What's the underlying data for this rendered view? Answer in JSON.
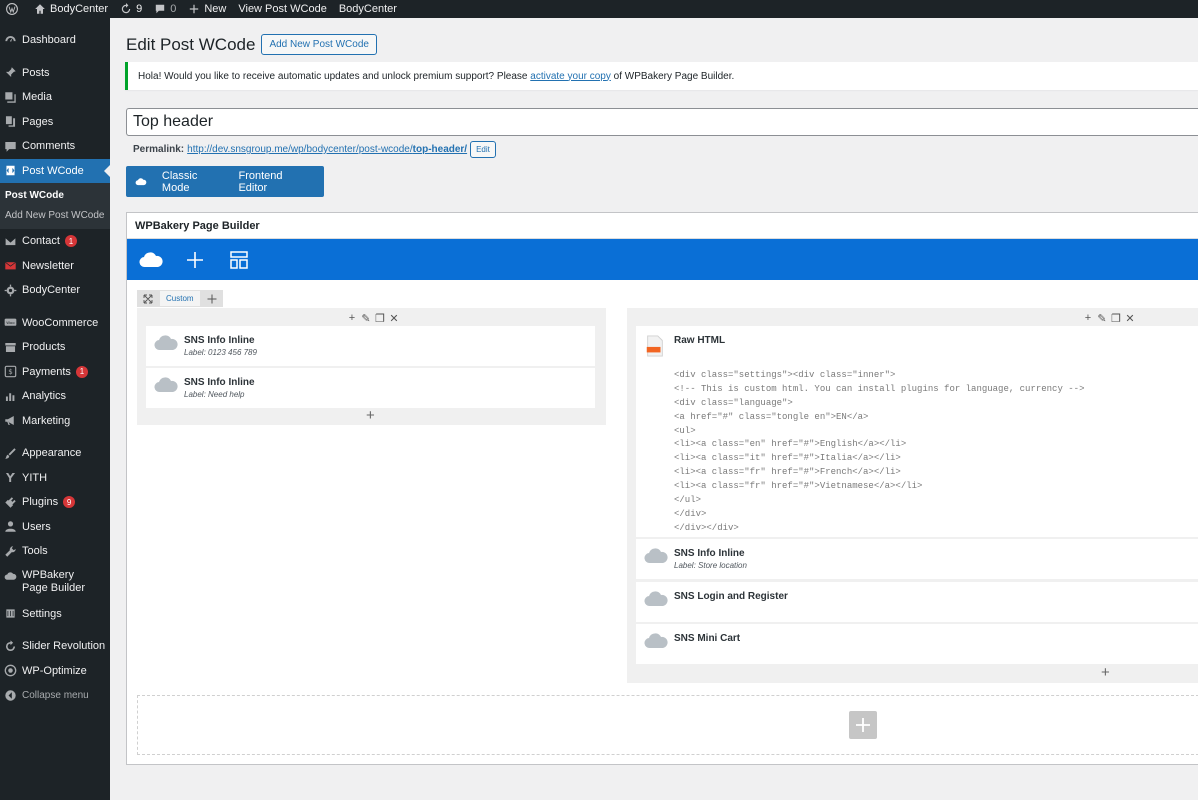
{
  "adminbar": {
    "site_name": "BodyCenter",
    "updates_count": "9",
    "comments_count": "0",
    "new_label": "New",
    "view_label": "View Post WCode",
    "theme_label": "BodyCenter"
  },
  "sidebar": {
    "items": [
      {
        "label": "Dashboard",
        "icon": "dashboard-icon"
      },
      {
        "label": "Posts",
        "icon": "pin-icon"
      },
      {
        "label": "Media",
        "icon": "media-icon"
      },
      {
        "label": "Pages",
        "icon": "pages-icon"
      },
      {
        "label": "Comments",
        "icon": "comments-icon"
      },
      {
        "label": "Post WCode",
        "icon": "code-icon",
        "current": true
      },
      {
        "label": "Contact",
        "icon": "mail-icon",
        "badge": "1"
      },
      {
        "label": "Newsletter",
        "icon": "envelope-icon"
      },
      {
        "label": "BodyCenter",
        "icon": "gear-icon"
      },
      {
        "label": "WooCommerce",
        "icon": "woo-icon"
      },
      {
        "label": "Products",
        "icon": "archive-icon"
      },
      {
        "label": "Payments",
        "icon": "dollar-icon",
        "badge": "1"
      },
      {
        "label": "Analytics",
        "icon": "chart-icon"
      },
      {
        "label": "Marketing",
        "icon": "megaphone-icon"
      },
      {
        "label": "Appearance",
        "icon": "brush-icon"
      },
      {
        "label": "YITH",
        "icon": "yith-icon"
      },
      {
        "label": "Plugins",
        "icon": "plugin-icon",
        "badge": "9"
      },
      {
        "label": "Users",
        "icon": "users-icon"
      },
      {
        "label": "Tools",
        "icon": "wrench-icon"
      },
      {
        "label": "WPBakery Page Builder",
        "icon": "cloud-icon"
      },
      {
        "label": "Settings",
        "icon": "settings-icon"
      },
      {
        "label": "Slider Revolution",
        "icon": "refresh-icon"
      },
      {
        "label": "WP-Optimize",
        "icon": "optimize-icon"
      },
      {
        "label": "Collapse menu",
        "icon": "collapse-icon"
      }
    ],
    "submenu": [
      "Post WCode",
      "Add New Post WCode"
    ]
  },
  "header": {
    "title": "Edit Post WCode",
    "add_new": "Add New Post WCode"
  },
  "notice": {
    "text_before": "Hola! Would you like to receive automatic updates and unlock premium support? Please ",
    "link": "activate your copy",
    "text_after": " of WPBakery Page Builder."
  },
  "post": {
    "title": "Top header",
    "permalink_label": "Permalink:",
    "permalink_base": "http://dev.snsgroup.me/wp/bodycenter/post-wcode/",
    "permalink_slug": "top-header/",
    "edit_label": "Edit"
  },
  "modes": {
    "classic": "Classic Mode",
    "frontend": "Frontend Editor"
  },
  "builder": {
    "title": "WPBakery Page Builder",
    "row_tab": "Custom",
    "left_column": [
      {
        "title": "SNS Info Inline",
        "label": "Label: 0123 456 789"
      },
      {
        "title": "SNS Info Inline",
        "label": "Label: Need help"
      }
    ],
    "raw_html": {
      "title": "Raw HTML",
      "lines": [
        "<div class=\"settings\"><div class=\"inner\">",
        "<!-- This is custom html. You can install plugins for language, currency -->",
        "<div class=\"language\">",
        "<a href=\"#\" class=\"tongle en\">EN</a>",
        "<ul>",
        "<li><a class=\"en\" href=\"#\">English</a></li>",
        "<li><a class=\"it\" href=\"#\">Italia</a></li>",
        "<li><a class=\"fr\" href=\"#\">French</a></li>",
        "<li><a class=\"fr\" href=\"#\">Vietnamese</a></li>",
        "</ul>",
        "</div>",
        "</div></div>"
      ]
    },
    "right_column": [
      {
        "title": "SNS Info Inline",
        "label": "Label: Store location"
      },
      {
        "title": "SNS Login and Register",
        "label": ""
      },
      {
        "title": "SNS Mini Cart",
        "label": ""
      }
    ]
  },
  "colors": {
    "wp_blue": "#2271b1",
    "builder_blue": "#0a6fd6",
    "sidebar_bg": "#1d2327",
    "badge_red": "#d63638",
    "notice_green": "#00a32a"
  }
}
